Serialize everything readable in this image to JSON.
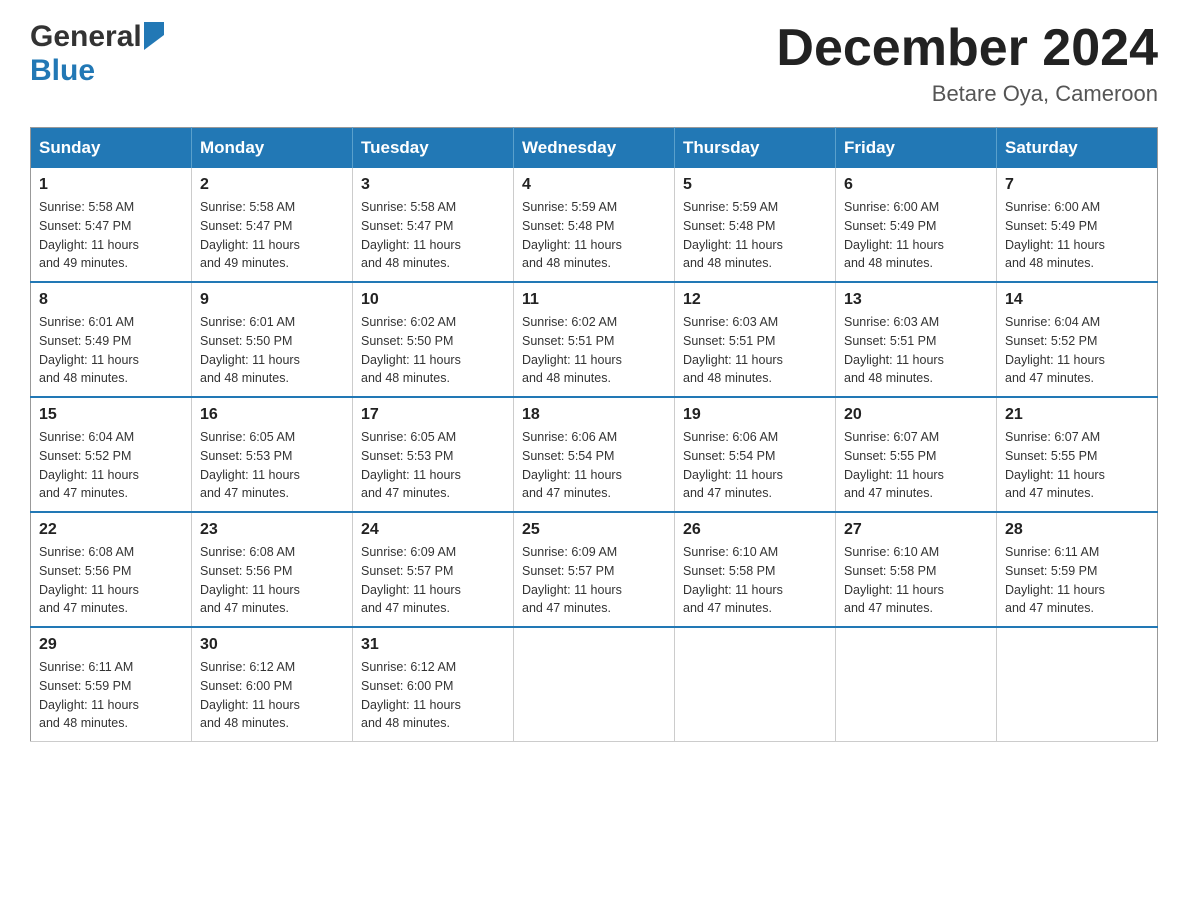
{
  "header": {
    "logo_general": "General",
    "logo_blue": "Blue",
    "month_title": "December 2024",
    "subtitle": "Betare Oya, Cameroon"
  },
  "days_of_week": [
    "Sunday",
    "Monday",
    "Tuesday",
    "Wednesday",
    "Thursday",
    "Friday",
    "Saturday"
  ],
  "weeks": [
    [
      {
        "day": "1",
        "sunrise": "Sunrise: 5:58 AM",
        "sunset": "Sunset: 5:47 PM",
        "daylight": "Daylight: 11 hours and 49 minutes."
      },
      {
        "day": "2",
        "sunrise": "Sunrise: 5:58 AM",
        "sunset": "Sunset: 5:47 PM",
        "daylight": "Daylight: 11 hours and 49 minutes."
      },
      {
        "day": "3",
        "sunrise": "Sunrise: 5:58 AM",
        "sunset": "Sunset: 5:47 PM",
        "daylight": "Daylight: 11 hours and 48 minutes."
      },
      {
        "day": "4",
        "sunrise": "Sunrise: 5:59 AM",
        "sunset": "Sunset: 5:48 PM",
        "daylight": "Daylight: 11 hours and 48 minutes."
      },
      {
        "day": "5",
        "sunrise": "Sunrise: 5:59 AM",
        "sunset": "Sunset: 5:48 PM",
        "daylight": "Daylight: 11 hours and 48 minutes."
      },
      {
        "day": "6",
        "sunrise": "Sunrise: 6:00 AM",
        "sunset": "Sunset: 5:49 PM",
        "daylight": "Daylight: 11 hours and 48 minutes."
      },
      {
        "day": "7",
        "sunrise": "Sunrise: 6:00 AM",
        "sunset": "Sunset: 5:49 PM",
        "daylight": "Daylight: 11 hours and 48 minutes."
      }
    ],
    [
      {
        "day": "8",
        "sunrise": "Sunrise: 6:01 AM",
        "sunset": "Sunset: 5:49 PM",
        "daylight": "Daylight: 11 hours and 48 minutes."
      },
      {
        "day": "9",
        "sunrise": "Sunrise: 6:01 AM",
        "sunset": "Sunset: 5:50 PM",
        "daylight": "Daylight: 11 hours and 48 minutes."
      },
      {
        "day": "10",
        "sunrise": "Sunrise: 6:02 AM",
        "sunset": "Sunset: 5:50 PM",
        "daylight": "Daylight: 11 hours and 48 minutes."
      },
      {
        "day": "11",
        "sunrise": "Sunrise: 6:02 AM",
        "sunset": "Sunset: 5:51 PM",
        "daylight": "Daylight: 11 hours and 48 minutes."
      },
      {
        "day": "12",
        "sunrise": "Sunrise: 6:03 AM",
        "sunset": "Sunset: 5:51 PM",
        "daylight": "Daylight: 11 hours and 48 minutes."
      },
      {
        "day": "13",
        "sunrise": "Sunrise: 6:03 AM",
        "sunset": "Sunset: 5:51 PM",
        "daylight": "Daylight: 11 hours and 48 minutes."
      },
      {
        "day": "14",
        "sunrise": "Sunrise: 6:04 AM",
        "sunset": "Sunset: 5:52 PM",
        "daylight": "Daylight: 11 hours and 47 minutes."
      }
    ],
    [
      {
        "day": "15",
        "sunrise": "Sunrise: 6:04 AM",
        "sunset": "Sunset: 5:52 PM",
        "daylight": "Daylight: 11 hours and 47 minutes."
      },
      {
        "day": "16",
        "sunrise": "Sunrise: 6:05 AM",
        "sunset": "Sunset: 5:53 PM",
        "daylight": "Daylight: 11 hours and 47 minutes."
      },
      {
        "day": "17",
        "sunrise": "Sunrise: 6:05 AM",
        "sunset": "Sunset: 5:53 PM",
        "daylight": "Daylight: 11 hours and 47 minutes."
      },
      {
        "day": "18",
        "sunrise": "Sunrise: 6:06 AM",
        "sunset": "Sunset: 5:54 PM",
        "daylight": "Daylight: 11 hours and 47 minutes."
      },
      {
        "day": "19",
        "sunrise": "Sunrise: 6:06 AM",
        "sunset": "Sunset: 5:54 PM",
        "daylight": "Daylight: 11 hours and 47 minutes."
      },
      {
        "day": "20",
        "sunrise": "Sunrise: 6:07 AM",
        "sunset": "Sunset: 5:55 PM",
        "daylight": "Daylight: 11 hours and 47 minutes."
      },
      {
        "day": "21",
        "sunrise": "Sunrise: 6:07 AM",
        "sunset": "Sunset: 5:55 PM",
        "daylight": "Daylight: 11 hours and 47 minutes."
      }
    ],
    [
      {
        "day": "22",
        "sunrise": "Sunrise: 6:08 AM",
        "sunset": "Sunset: 5:56 PM",
        "daylight": "Daylight: 11 hours and 47 minutes."
      },
      {
        "day": "23",
        "sunrise": "Sunrise: 6:08 AM",
        "sunset": "Sunset: 5:56 PM",
        "daylight": "Daylight: 11 hours and 47 minutes."
      },
      {
        "day": "24",
        "sunrise": "Sunrise: 6:09 AM",
        "sunset": "Sunset: 5:57 PM",
        "daylight": "Daylight: 11 hours and 47 minutes."
      },
      {
        "day": "25",
        "sunrise": "Sunrise: 6:09 AM",
        "sunset": "Sunset: 5:57 PM",
        "daylight": "Daylight: 11 hours and 47 minutes."
      },
      {
        "day": "26",
        "sunrise": "Sunrise: 6:10 AM",
        "sunset": "Sunset: 5:58 PM",
        "daylight": "Daylight: 11 hours and 47 minutes."
      },
      {
        "day": "27",
        "sunrise": "Sunrise: 6:10 AM",
        "sunset": "Sunset: 5:58 PM",
        "daylight": "Daylight: 11 hours and 47 minutes."
      },
      {
        "day": "28",
        "sunrise": "Sunrise: 6:11 AM",
        "sunset": "Sunset: 5:59 PM",
        "daylight": "Daylight: 11 hours and 47 minutes."
      }
    ],
    [
      {
        "day": "29",
        "sunrise": "Sunrise: 6:11 AM",
        "sunset": "Sunset: 5:59 PM",
        "daylight": "Daylight: 11 hours and 48 minutes."
      },
      {
        "day": "30",
        "sunrise": "Sunrise: 6:12 AM",
        "sunset": "Sunset: 6:00 PM",
        "daylight": "Daylight: 11 hours and 48 minutes."
      },
      {
        "day": "31",
        "sunrise": "Sunrise: 6:12 AM",
        "sunset": "Sunset: 6:00 PM",
        "daylight": "Daylight: 11 hours and 48 minutes."
      },
      null,
      null,
      null,
      null
    ]
  ]
}
